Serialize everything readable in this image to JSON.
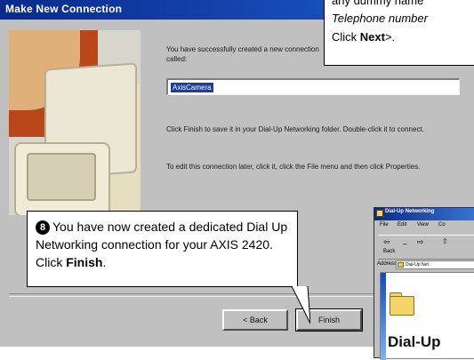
{
  "dialog": {
    "title": "Make New Connection",
    "success_text": "You have successfully created a new connection called:",
    "connection_name": "AxisCamera",
    "finish_hint": "Click Finish to save it in your Dial-Up Networking folder. Double-click it to connect.",
    "edit_hint": "To edit this connection later, click it, click the File menu and then click Properties.",
    "back_label": "< Back",
    "finish_label": "Finish"
  },
  "top_instruction": {
    "line1": "any dummy name",
    "line2": "Telephone number",
    "line3_prefix": "Click ",
    "line3_bold": "Next",
    "line3_suffix": ">."
  },
  "callout": {
    "step_number": "8",
    "text_prefix": "You have now created a dedicated Dial Up Networking connection for your AXIS 2420. Click ",
    "text_bold": "Finish",
    "text_suffix": "."
  },
  "dun_window": {
    "title": "Dial-Up Networking",
    "menus": [
      "File",
      "Edit",
      "View",
      "Co"
    ],
    "toolbar_back": "Back",
    "address_label": "Address",
    "address_value": "Dial-Up Net",
    "big_label": "Dial-Up"
  },
  "icons": {
    "dun_title_icon": "dial-up-networking-icon",
    "folder": "folder-icon"
  }
}
